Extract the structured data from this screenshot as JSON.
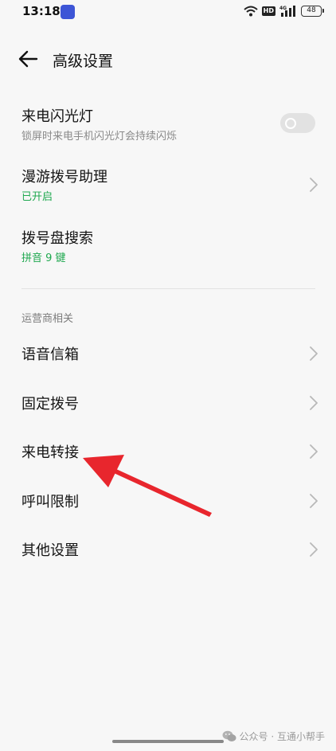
{
  "status_bar": {
    "time": "13:18",
    "hd_label": "HD",
    "network_label": "4G",
    "battery": "48"
  },
  "header": {
    "title": "高级设置"
  },
  "settings": {
    "flash": {
      "title": "来电闪光灯",
      "subtitle": "锁屏时来电手机闪光灯会持续闪烁",
      "enabled": false
    },
    "roaming": {
      "title": "漫游拨号助理",
      "subtitle": "已开启"
    },
    "dialpad_search": {
      "title": "拨号盘搜索",
      "subtitle": "拼音 9 键"
    }
  },
  "carrier_section": {
    "label": "运营商相关",
    "items": [
      {
        "title": "语音信箱"
      },
      {
        "title": "固定拨号"
      },
      {
        "title": "来电转接"
      },
      {
        "title": "呼叫限制"
      },
      {
        "title": "其他设置"
      }
    ]
  },
  "watermark": {
    "text": "公众号 · 互通小帮手"
  },
  "colors": {
    "accent_green": "#1fa84f",
    "annotation_arrow": "#e8262d"
  }
}
